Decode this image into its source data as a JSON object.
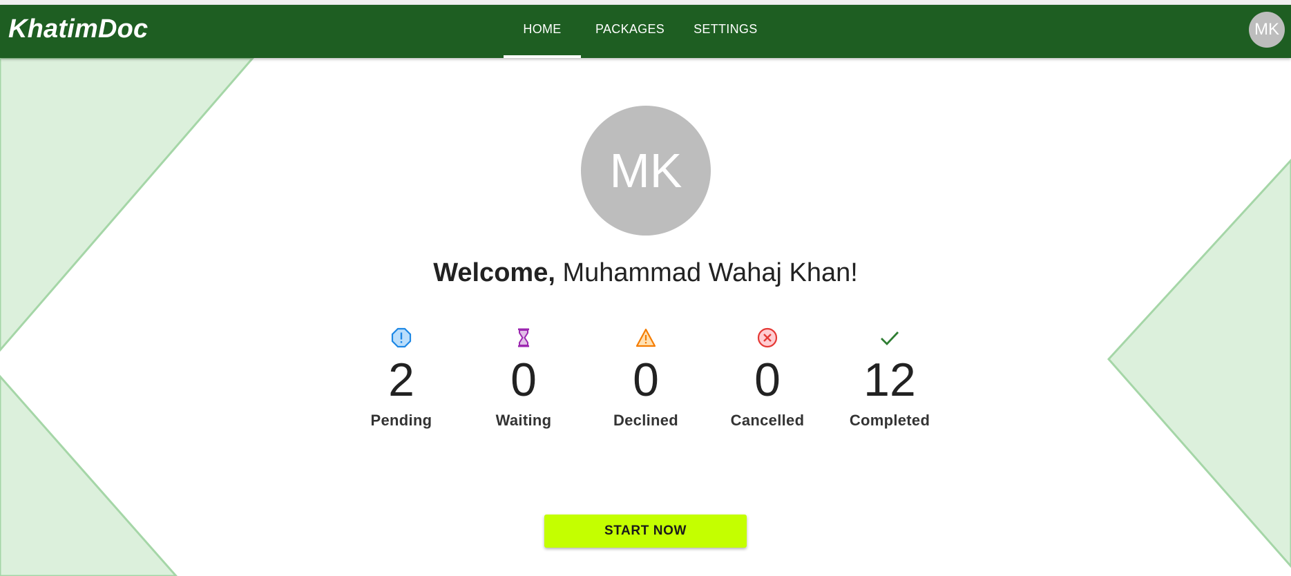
{
  "brand": {
    "name": "KhatimDoc"
  },
  "nav": {
    "tabs": [
      {
        "label": "HOME",
        "active": true
      },
      {
        "label": "PACKAGES",
        "active": false
      },
      {
        "label": "SETTINGS",
        "active": false
      }
    ],
    "user_initials": "MK"
  },
  "profile": {
    "initials": "MK",
    "welcome_prefix": "Welcome,",
    "user_name": "Muhammad Wahaj Khan!"
  },
  "stats": [
    {
      "value": "2",
      "label": "Pending",
      "icon": "exclamation-octagon-icon",
      "color": "#1e88e5"
    },
    {
      "value": "0",
      "label": "Waiting",
      "icon": "hourglass-icon",
      "color": "#9c27b0"
    },
    {
      "value": "0",
      "label": "Declined",
      "icon": "warning-triangle-icon",
      "color": "#f57c00"
    },
    {
      "value": "0",
      "label": "Cancelled",
      "icon": "cancel-circle-icon",
      "color": "#e53935"
    },
    {
      "value": "12",
      "label": "Completed",
      "icon": "check-icon",
      "color": "#2e7d32"
    }
  ],
  "cta": {
    "label": "START NOW"
  },
  "colors": {
    "navbar": "#1e5e22",
    "background_shape": "#dcf0dc",
    "background_shape_border": "#a5d6a7",
    "cta": "#c4ff00",
    "avatar": "#bdbdbd"
  }
}
